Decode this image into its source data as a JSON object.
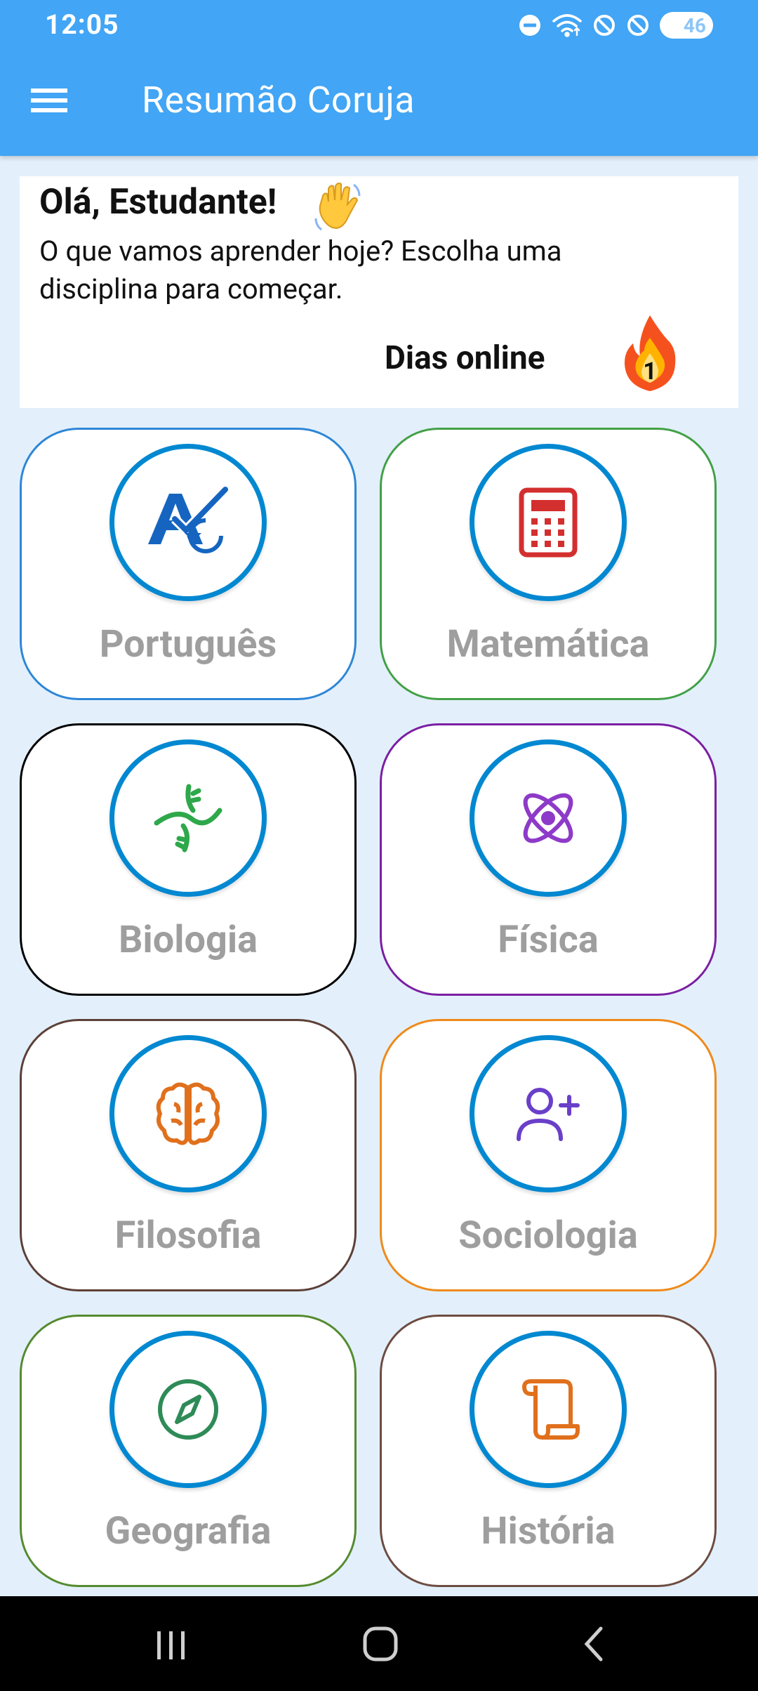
{
  "status_bar": {
    "time": "12:05",
    "battery": "46"
  },
  "app_bar": {
    "title": "Resumão Coruja"
  },
  "greeting": {
    "title": "Olá, Estudante!",
    "subtitle": "O que vamos aprender hoje? Escolha uma disciplina para começar.",
    "days_label": "Dias online",
    "days_count": "1"
  },
  "subjects": [
    {
      "label": "Português",
      "icon": "portuguese-check-icon",
      "border": "#2E86D6"
    },
    {
      "label": "Matemática",
      "icon": "calculator-icon",
      "border": "#43A047"
    },
    {
      "label": "Biologia",
      "icon": "dna-icon",
      "border": "#000000"
    },
    {
      "label": "Física",
      "icon": "atom-icon",
      "border": "#7B1FA2"
    },
    {
      "label": "Filosofia",
      "icon": "brain-icon",
      "border": "#5D4037"
    },
    {
      "label": "Sociologia",
      "icon": "user-plus-icon",
      "border": "#EF8A1A"
    },
    {
      "label": "Geografia",
      "icon": "compass-icon",
      "border": "#558B2F"
    },
    {
      "label": "História",
      "icon": "scroll-icon",
      "border": "#6D4C41"
    }
  ],
  "colors": {
    "app_bar": "#42A5F5",
    "background": "#E3F0FC",
    "icon_ring": "#0288D1",
    "label_gray": "#9E9E9E"
  }
}
